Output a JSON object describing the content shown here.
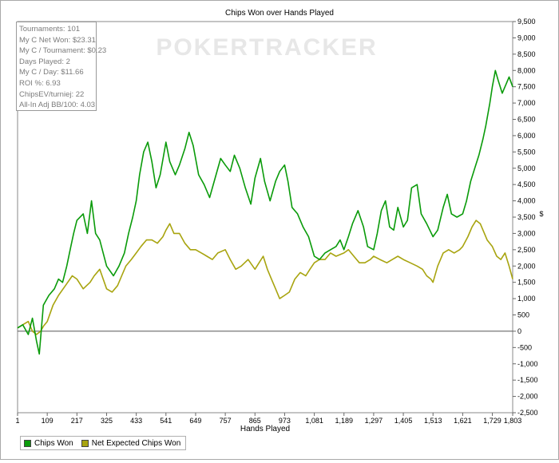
{
  "stats": [
    "Tournaments: 101",
    "My C Net Won: $23.31",
    "My C / Tournament: $0.23",
    "Days Played: 2",
    "My C / Day: $11.66",
    "ROI %: 6.93",
    "ChipsEV/turniej: 22",
    "All-In Adj BB/100: 4.03"
  ],
  "watermark": "POKERTRACKER",
  "chart_data": {
    "type": "line",
    "title": "Chips Won over Hands Played",
    "xlabel": "Hands Played",
    "ylabel": "$",
    "xlim": [
      1,
      1803
    ],
    "ylim": [
      -2500,
      9500
    ],
    "x_ticks": [
      1,
      109,
      217,
      325,
      433,
      541,
      649,
      757,
      865,
      973,
      1081,
      1189,
      1297,
      1405,
      1513,
      1621,
      1729,
      1803
    ],
    "x_tick_labels": [
      "1",
      "109",
      "217",
      "325",
      "433",
      "541",
      "649",
      "757",
      "865",
      "973",
      "1,081",
      "1,189",
      "1,297",
      "1,405",
      "1,513",
      "1,621",
      "1,729",
      "1,803"
    ],
    "y_ticks": [
      -2500,
      -2000,
      -1500,
      -1000,
      -500,
      0,
      500,
      1000,
      1500,
      2000,
      2500,
      3000,
      3500,
      4000,
      4500,
      5000,
      5500,
      6000,
      6500,
      7000,
      7500,
      8000,
      8500,
      9000,
      9500
    ],
    "y_tick_labels": [
      "-2,500",
      "-2,000",
      "-1,500",
      "-1,000",
      "-500",
      "0",
      "500",
      "1,000",
      "1,500",
      "2,000",
      "2,500",
      "3,000",
      "3,500",
      "4,000",
      "4,500",
      "5,000",
      "5,500",
      "6,000",
      "6,500",
      "7,000",
      "7,500",
      "8,000",
      "8,500",
      "9,000",
      "9,500"
    ],
    "grid": false,
    "legend_position": "bottom-left",
    "series": [
      {
        "name": "Chips Won",
        "color": "#0a9b0a",
        "points": [
          [
            1,
            100
          ],
          [
            20,
            200
          ],
          [
            40,
            -100
          ],
          [
            55,
            400
          ],
          [
            70,
            -300
          ],
          [
            80,
            -700
          ],
          [
            95,
            800
          ],
          [
            115,
            1100
          ],
          [
            135,
            1300
          ],
          [
            150,
            1600
          ],
          [
            165,
            1500
          ],
          [
            180,
            2000
          ],
          [
            195,
            2600
          ],
          [
            205,
            3000
          ],
          [
            217,
            3400
          ],
          [
            240,
            3600
          ],
          [
            255,
            3000
          ],
          [
            270,
            4000
          ],
          [
            285,
            3000
          ],
          [
            300,
            2800
          ],
          [
            325,
            2000
          ],
          [
            350,
            1700
          ],
          [
            370,
            2000
          ],
          [
            390,
            2400
          ],
          [
            405,
            3000
          ],
          [
            420,
            3500
          ],
          [
            433,
            4000
          ],
          [
            445,
            4800
          ],
          [
            460,
            5500
          ],
          [
            475,
            5800
          ],
          [
            490,
            5200
          ],
          [
            505,
            4400
          ],
          [
            520,
            4800
          ],
          [
            541,
            5800
          ],
          [
            555,
            5200
          ],
          [
            575,
            4800
          ],
          [
            590,
            5100
          ],
          [
            610,
            5600
          ],
          [
            625,
            6100
          ],
          [
            640,
            5700
          ],
          [
            660,
            4800
          ],
          [
            680,
            4500
          ],
          [
            700,
            4100
          ],
          [
            720,
            4700
          ],
          [
            740,
            5300
          ],
          [
            757,
            5100
          ],
          [
            775,
            4900
          ],
          [
            790,
            5400
          ],
          [
            810,
            5000
          ],
          [
            830,
            4400
          ],
          [
            850,
            3900
          ],
          [
            865,
            4700
          ],
          [
            885,
            5300
          ],
          [
            900,
            4600
          ],
          [
            920,
            4000
          ],
          [
            940,
            4600
          ],
          [
            955,
            4900
          ],
          [
            973,
            5100
          ],
          [
            985,
            4600
          ],
          [
            1000,
            3800
          ],
          [
            1020,
            3600
          ],
          [
            1040,
            3200
          ],
          [
            1060,
            2900
          ],
          [
            1081,
            2300
          ],
          [
            1100,
            2200
          ],
          [
            1120,
            2400
          ],
          [
            1140,
            2500
          ],
          [
            1160,
            2600
          ],
          [
            1175,
            2800
          ],
          [
            1189,
            2500
          ],
          [
            1205,
            2900
          ],
          [
            1220,
            3300
          ],
          [
            1240,
            3700
          ],
          [
            1260,
            3200
          ],
          [
            1275,
            2600
          ],
          [
            1297,
            2500
          ],
          [
            1310,
            3000
          ],
          [
            1325,
            3700
          ],
          [
            1340,
            4000
          ],
          [
            1355,
            3200
          ],
          [
            1370,
            3100
          ],
          [
            1385,
            3800
          ],
          [
            1405,
            3200
          ],
          [
            1420,
            3400
          ],
          [
            1435,
            4400
          ],
          [
            1455,
            4500
          ],
          [
            1470,
            3600
          ],
          [
            1490,
            3300
          ],
          [
            1513,
            2900
          ],
          [
            1530,
            3100
          ],
          [
            1550,
            3800
          ],
          [
            1565,
            4200
          ],
          [
            1580,
            3600
          ],
          [
            1600,
            3500
          ],
          [
            1621,
            3600
          ],
          [
            1635,
            4000
          ],
          [
            1650,
            4600
          ],
          [
            1665,
            5000
          ],
          [
            1680,
            5400
          ],
          [
            1695,
            5900
          ],
          [
            1705,
            6300
          ],
          [
            1720,
            7000
          ],
          [
            1729,
            7500
          ],
          [
            1740,
            8000
          ],
          [
            1750,
            7700
          ],
          [
            1765,
            7300
          ],
          [
            1780,
            7600
          ],
          [
            1790,
            7800
          ],
          [
            1803,
            7500
          ]
        ]
      },
      {
        "name": "Net Expected Chips Won",
        "color": "#a8a40f",
        "points": [
          [
            1,
            100
          ],
          [
            20,
            200
          ],
          [
            40,
            300
          ],
          [
            55,
            0
          ],
          [
            70,
            -100
          ],
          [
            85,
            0
          ],
          [
            95,
            150
          ],
          [
            109,
            300
          ],
          [
            130,
            800
          ],
          [
            150,
            1100
          ],
          [
            175,
            1400
          ],
          [
            200,
            1700
          ],
          [
            217,
            1600
          ],
          [
            240,
            1300
          ],
          [
            265,
            1500
          ],
          [
            280,
            1700
          ],
          [
            300,
            1900
          ],
          [
            325,
            1300
          ],
          [
            345,
            1200
          ],
          [
            365,
            1400
          ],
          [
            380,
            1700
          ],
          [
            395,
            2000
          ],
          [
            415,
            2200
          ],
          [
            433,
            2400
          ],
          [
            450,
            2600
          ],
          [
            470,
            2800
          ],
          [
            490,
            2800
          ],
          [
            510,
            2700
          ],
          [
            530,
            2900
          ],
          [
            541,
            3100
          ],
          [
            555,
            3300
          ],
          [
            570,
            3000
          ],
          [
            590,
            3000
          ],
          [
            610,
            2700
          ],
          [
            630,
            2500
          ],
          [
            649,
            2500
          ],
          [
            670,
            2400
          ],
          [
            690,
            2300
          ],
          [
            710,
            2200
          ],
          [
            730,
            2400
          ],
          [
            757,
            2500
          ],
          [
            775,
            2200
          ],
          [
            795,
            1900
          ],
          [
            815,
            2000
          ],
          [
            840,
            2200
          ],
          [
            865,
            1900
          ],
          [
            880,
            2100
          ],
          [
            895,
            2300
          ],
          [
            910,
            1900
          ],
          [
            925,
            1600
          ],
          [
            940,
            1300
          ],
          [
            955,
            1000
          ],
          [
            973,
            1100
          ],
          [
            990,
            1200
          ],
          [
            1010,
            1600
          ],
          [
            1030,
            1800
          ],
          [
            1050,
            1700
          ],
          [
            1065,
            1900
          ],
          [
            1081,
            2100
          ],
          [
            1100,
            2200
          ],
          [
            1120,
            2200
          ],
          [
            1140,
            2400
          ],
          [
            1160,
            2300
          ],
          [
            1189,
            2400
          ],
          [
            1205,
            2500
          ],
          [
            1225,
            2300
          ],
          [
            1245,
            2100
          ],
          [
            1265,
            2100
          ],
          [
            1285,
            2200
          ],
          [
            1297,
            2300
          ],
          [
            1320,
            2200
          ],
          [
            1345,
            2100
          ],
          [
            1365,
            2200
          ],
          [
            1385,
            2300
          ],
          [
            1405,
            2200
          ],
          [
            1430,
            2100
          ],
          [
            1455,
            2000
          ],
          [
            1475,
            1900
          ],
          [
            1490,
            1700
          ],
          [
            1505,
            1600
          ],
          [
            1513,
            1500
          ],
          [
            1530,
            2000
          ],
          [
            1550,
            2400
          ],
          [
            1570,
            2500
          ],
          [
            1590,
            2400
          ],
          [
            1610,
            2500
          ],
          [
            1621,
            2600
          ],
          [
            1640,
            2900
          ],
          [
            1655,
            3200
          ],
          [
            1670,
            3400
          ],
          [
            1685,
            3300
          ],
          [
            1700,
            3000
          ],
          [
            1710,
            2800
          ],
          [
            1729,
            2600
          ],
          [
            1745,
            2300
          ],
          [
            1760,
            2200
          ],
          [
            1775,
            2400
          ],
          [
            1790,
            2000
          ],
          [
            1803,
            1600
          ]
        ]
      }
    ]
  }
}
